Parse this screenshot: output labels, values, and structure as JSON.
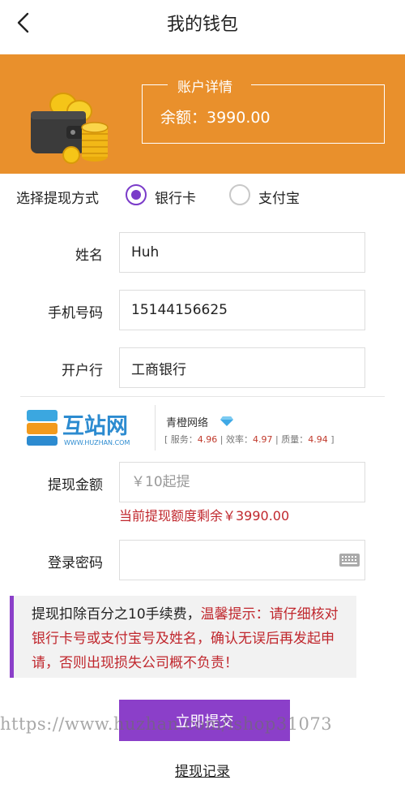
{
  "header": {
    "title": "我的钱包"
  },
  "account": {
    "title": "账户详情",
    "balance": "余额：3990.00"
  },
  "method": {
    "label": "选择提现方式",
    "options": [
      {
        "label": "银行卡",
        "checked": true
      },
      {
        "label": "支付宝",
        "checked": false
      }
    ]
  },
  "form": {
    "name_label": "姓名",
    "name_value": "Huh",
    "phone_label": "手机号码",
    "phone_value": "15144156625",
    "bank_label": "开户行",
    "bank_value": "工商银行",
    "amount_label": "提现金额",
    "amount_placeholder": "￥10起提",
    "quota_text": "当前提现额度剩余￥3990.00",
    "password_label": "登录密码",
    "password_value": ""
  },
  "ad": {
    "logo_text": "互站网",
    "logo_url": "WWW.HUZHAN.COM",
    "name": "青橙网络",
    "service_label": "服务：",
    "service_value": "4.96",
    "efficiency_label": "效率：",
    "efficiency_value": "4.97",
    "quality_label": "质量：",
    "quality_value": "4.94"
  },
  "notice": {
    "part1": "提现扣除百分之10手续费，",
    "part2": "温馨提示：请仔细核对银行卡号或支付宝号及姓名，确认无误后再发起申请，否则出现损失公司概不负责！"
  },
  "submit_label": "立即提交",
  "watermark": "https://www.huzhan.com/ishop31073",
  "history_label": "提现记录",
  "colors": {
    "banner": "#E9902C",
    "accent": "#8B3FC9",
    "warning": "#C0272D"
  }
}
